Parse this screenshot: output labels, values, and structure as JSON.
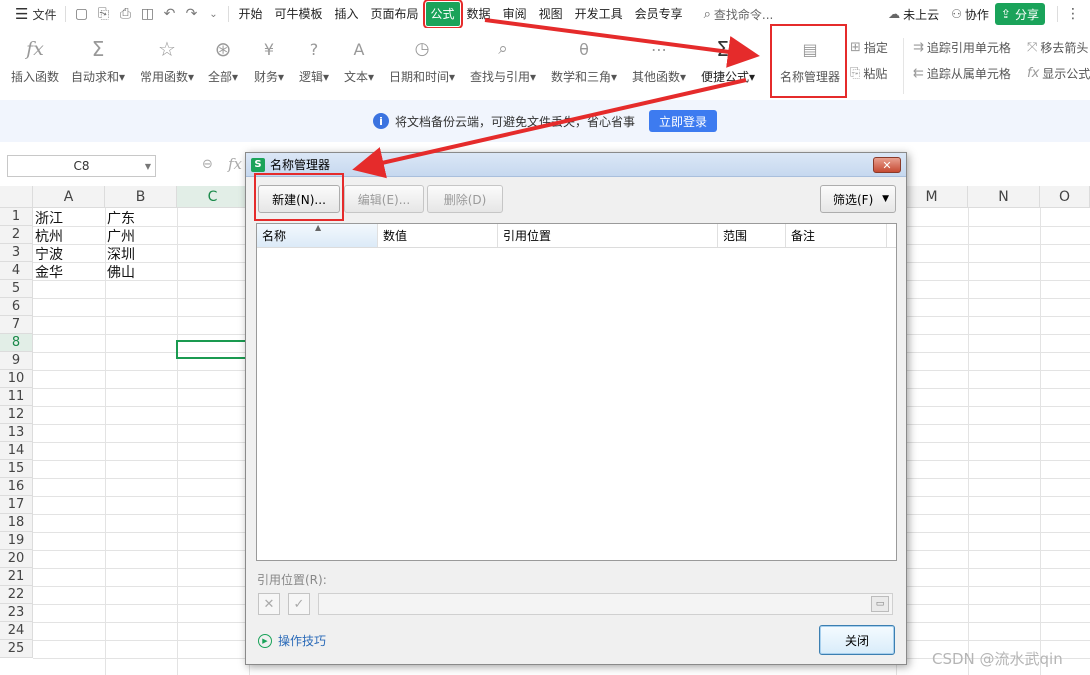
{
  "menubar": {
    "file_label": "文件",
    "tabs": [
      "开始",
      "可牛模板",
      "插入",
      "页面布局",
      "公式",
      "数据",
      "审阅",
      "视图",
      "开发工具",
      "会员专享"
    ],
    "active_tab": "公式",
    "search_placeholder": "查找命令...",
    "cloud_label": "未上云",
    "collab_label": "协作",
    "share_label": "分享"
  },
  "ribbon": {
    "items": [
      {
        "icon": "fx-icon",
        "label": "插入函数"
      },
      {
        "icon": "sigma-icon",
        "label": "自动求和▾"
      },
      {
        "icon": "star-icon",
        "label": "常用函数▾"
      },
      {
        "icon": "all-functions-icon",
        "label": "全部▾"
      },
      {
        "icon": "yen-icon",
        "label": "财务▾"
      },
      {
        "icon": "question-icon",
        "label": "逻辑▾"
      },
      {
        "icon": "text-a-icon",
        "label": "文本▾"
      },
      {
        "icon": "clock-icon",
        "label": "日期和时间▾"
      },
      {
        "icon": "magnifier-icon",
        "label": "查找与引用▾"
      },
      {
        "icon": "theta-icon",
        "label": "数学和三角▾"
      },
      {
        "icon": "more-functions-icon",
        "label": "其他函数▾"
      },
      {
        "icon": "quick-formula-icon",
        "label": "便捷公式▾"
      },
      {
        "icon": "name-manager-icon",
        "label": "名称管理器"
      }
    ],
    "small": {
      "assign": "指定",
      "paste": "粘贴",
      "trace_precedents": "追踪引用单元格",
      "trace_dependents": "追踪从属单元格",
      "remove_arrows": "移去箭头",
      "show_formulas": "显示公式"
    }
  },
  "notice": {
    "text": "将文档备份云端，可避免文件丢失，省心省事",
    "button": "立即登录"
  },
  "formula_bar": {
    "cell_ref": "C8",
    "fx_label": "fx"
  },
  "sheet": {
    "columns": [
      "A",
      "B",
      "C",
      "M",
      "N",
      "O"
    ],
    "rows": [
      "1",
      "2",
      "3",
      "4",
      "5",
      "6",
      "7",
      "8",
      "9",
      "10",
      "11",
      "12",
      "13",
      "14",
      "15",
      "16",
      "17",
      "18",
      "19",
      "20",
      "21",
      "22",
      "23",
      "24",
      "25"
    ],
    "cells": [
      [
        "浙江",
        "广东"
      ],
      [
        "杭州",
        "广州"
      ],
      [
        "宁波",
        "深圳"
      ],
      [
        "金华",
        "佛山"
      ]
    ]
  },
  "dialog": {
    "title": "名称管理器",
    "new_btn": "新建(N)...",
    "edit_btn": "编辑(E)...",
    "delete_btn": "删除(D)",
    "filter_btn": "筛选(F)",
    "columns": [
      "名称",
      "数值",
      "引用位置",
      "范围",
      "备注"
    ],
    "ref_label": "引用位置(R):",
    "tips": "操作技巧",
    "close_btn": "关闭"
  },
  "watermark": "CSDN @流水武qin",
  "colors": {
    "accent_green": "#1aa35a",
    "highlight_red": "#e52b2b",
    "login_blue": "#3d7bf0"
  }
}
